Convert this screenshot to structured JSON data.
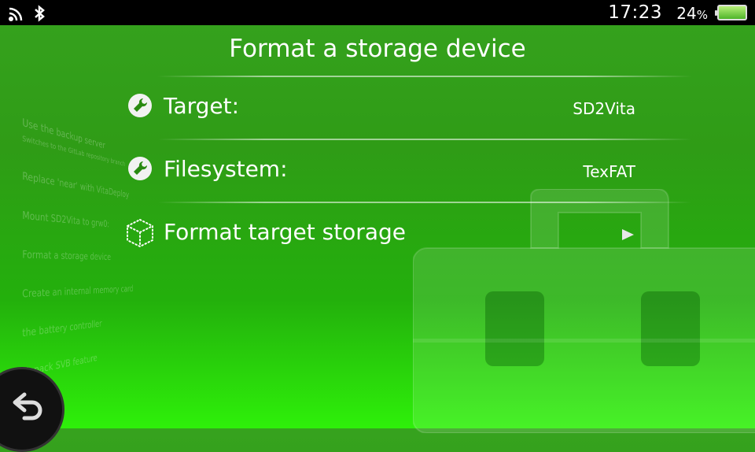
{
  "status_bar": {
    "time": "17:23",
    "battery_percent": "24",
    "battery_percent_sign": "%",
    "icons": [
      "wifi-icon",
      "bluetooth-icon",
      "battery-icon"
    ]
  },
  "title": "Format a storage device",
  "rows": [
    {
      "label": "Target:",
      "value": "SD2Vita",
      "icon": "wrench-icon"
    },
    {
      "label": "Filesystem:",
      "value": "TexFAT",
      "icon": "wrench-icon"
    },
    {
      "label": "Format target storage",
      "icon": "dotted-cube-icon"
    }
  ],
  "background_menu": [
    "Use the backup server",
    "Switches to the GitLab repository branch",
    "Replace 'near' with VitaDeploy",
    "Mount SD2Vita to grw0:",
    "Format a storage device",
    "Create an internal memory card",
    "the battery controller",
    "Unpack SVB feature"
  ],
  "colors": {
    "background_top": "#36a21e",
    "background_bottom": "#2ef00a",
    "status_bar": "#000000"
  }
}
